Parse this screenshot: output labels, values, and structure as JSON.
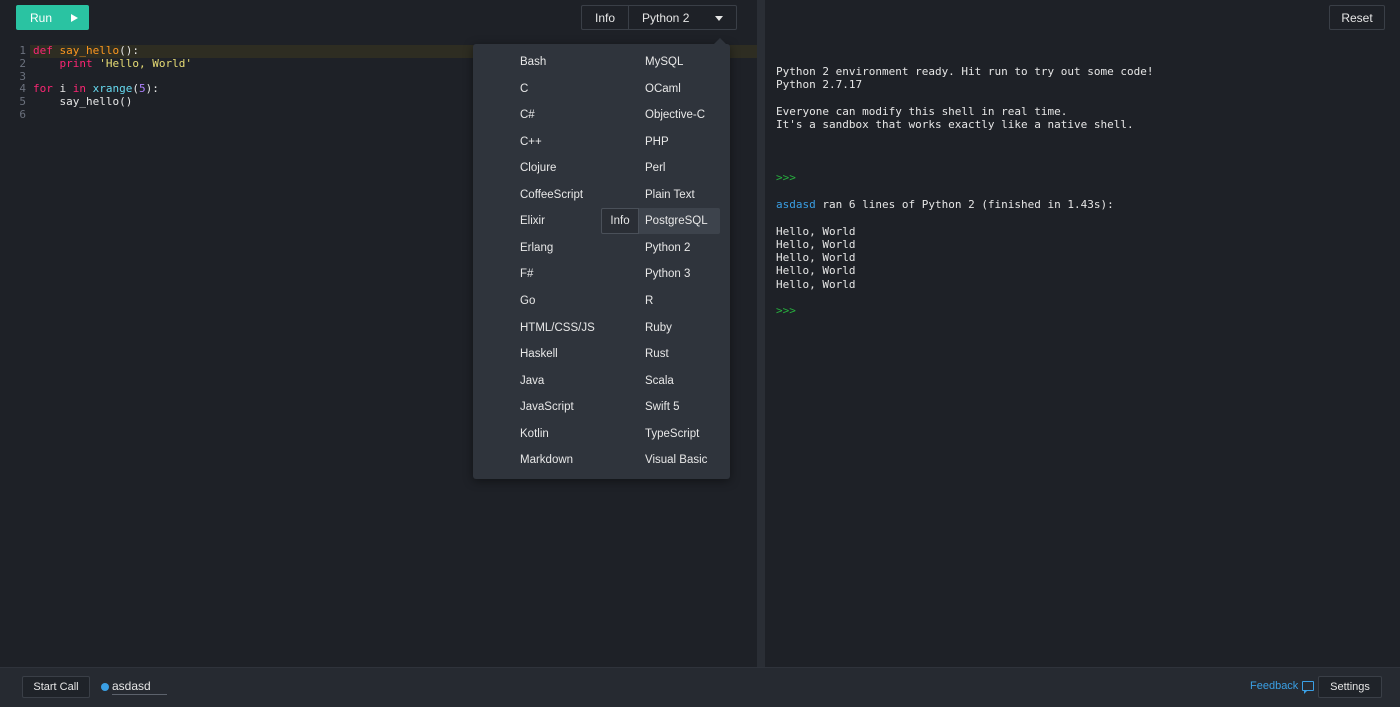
{
  "toolbar": {
    "run_label": "Run",
    "info_label": "Info",
    "language_selected": "Python 2",
    "reset_label": "Reset"
  },
  "editor": {
    "line_numbers": [
      "1",
      "2",
      "3",
      "4",
      "5",
      "6"
    ],
    "code": {
      "l1_kw": "def",
      "l1_fn": "say_hello",
      "l1_rest": "():",
      "l2_indent": "    ",
      "l2_kw": "print",
      "l2_str": "'Hello, World'",
      "l4_kw1": "for",
      "l4_var": " i ",
      "l4_kw2": "in",
      "l4_bi": "xrange",
      "l4_p1": "(",
      "l4_num": "5",
      "l4_p2": "):",
      "l5": "    say_hello()"
    }
  },
  "language_dropdown": {
    "left_column": [
      "Bash",
      "C",
      "C#",
      "C++",
      "Clojure",
      "CoffeeScript",
      "Elixir",
      "Erlang",
      "F#",
      "Go",
      "HTML/CSS/JS",
      "Haskell",
      "Java",
      "JavaScript",
      "Kotlin",
      "Markdown"
    ],
    "right_column": [
      "MySQL",
      "OCaml",
      "Objective-C",
      "PHP",
      "Perl",
      "Plain Text",
      "PostgreSQL",
      "Python 2",
      "Python 3",
      "R",
      "Ruby",
      "Rust",
      "Scala",
      "Swift 5",
      "TypeScript",
      "Visual Basic"
    ],
    "hovered_item": "PostgreSQL",
    "hover_info_label": "Info"
  },
  "shell": {
    "line1": "Python 2 environment ready. Hit run to try out some code!",
    "line2": "Python 2.7.17",
    "line3": "Everyone can modify this shell in real time.",
    "line4": "It's a sandbox that works exactly like a native shell.",
    "prompt": ">>>",
    "run_user": "asdasd",
    "run_message": " ran 6 lines of Python 2 (finished in 1.43s):",
    "outputs": [
      "Hello, World",
      "Hello, World",
      "Hello, World",
      "Hello, World",
      "Hello, World"
    ]
  },
  "footer": {
    "start_call_label": "Start Call",
    "username": "asdasd",
    "feedback_label": "Feedback",
    "settings_label": "Settings"
  },
  "colors": {
    "accent": "#2ac3a2",
    "link": "#3a9fe4",
    "prompt": "#27b03e",
    "background": "#1e2127",
    "dropdown": "#2f343c"
  },
  "icons": {
    "run": "play-icon",
    "language_select": "caret-down-icon",
    "feedback": "chat-bubble-icon",
    "user_status": "status-dot-icon"
  }
}
